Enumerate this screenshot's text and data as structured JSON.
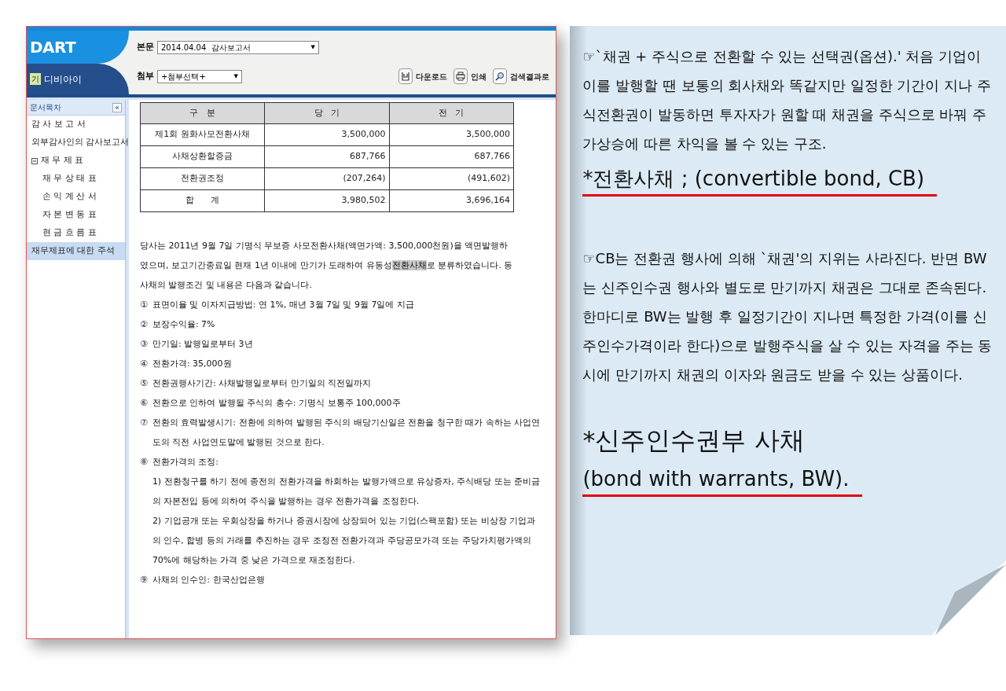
{
  "dart_window": {
    "header": {
      "logo": "DART",
      "brand_badge": "기",
      "brand": "디비아이",
      "fields": [
        {
          "label": "본문",
          "value": "2014.04.04  감사보고서",
          "arrow": "▼"
        },
        {
          "label": "첨부",
          "value": "+첨부선택+",
          "arrow": "▼"
        }
      ],
      "tools": [
        {
          "kind": "download",
          "label": "다운로드"
        },
        {
          "kind": "print",
          "label": "인쇄"
        },
        {
          "kind": "search",
          "label": "검색결과로"
        }
      ]
    },
    "sidebar": {
      "title": "문서목차",
      "collapse": "«",
      "items": [
        {
          "label": "감 사 보 고 서",
          "selected": false
        },
        {
          "label": "외부감사인의 감사보고서",
          "selected": false
        },
        {
          "label": "재 무 제 표",
          "selected": false,
          "expanded": true,
          "children": [
            {
              "label": "재 무 상 태 표",
              "selected": false
            },
            {
              "label": "손 익 계 산 서",
              "selected": false
            },
            {
              "label": "자 본 변 동 표",
              "selected": false
            },
            {
              "label": "현 금 흐 름 표",
              "selected": false
            }
          ]
        },
        {
          "label": "재무제표에 대한 주석",
          "selected": true
        }
      ]
    },
    "table": {
      "columns": [
        "구   분",
        "당   기",
        "전   기"
      ],
      "rows": [
        [
          "제1회 원화사모전환사채",
          "3,500,000",
          "3,500,000"
        ],
        [
          "사채상환할증금",
          "687,766",
          "687,766"
        ],
        [
          "전환권조정",
          "(207,264)",
          "(491,602)"
        ],
        [
          "합      계",
          "3,980,502",
          "3,696,164"
        ]
      ]
    },
    "paragraph": [
      {
        "text": "당사는 2011년 9월 7일 기명식 무보증 사모전환사채(액면가액: 3,500,000천원)을 액면발행하였으며, 보고기간종료일 현재 1년 이내에 만기가 도래하여 유동성",
        "highlighted": false
      },
      {
        "text": "전환사채",
        "highlighted": true
      },
      {
        "text": "로 분류하였습니다. 동 사채의 발행조건 및 내용은 다음과 같습니다.",
        "highlighted": false
      }
    ],
    "terms": [
      {
        "marker": "①",
        "text": "표면이율 및 이자지급방법: 연 1%, 매년 3월 7일 및 9월 7일에 지급"
      },
      {
        "marker": "②",
        "text": "보장수익율: 7%"
      },
      {
        "marker": "③",
        "text": "만기일: 발행일로부터 3년"
      },
      {
        "marker": "④",
        "text": "전환가격: 35,000원"
      },
      {
        "marker": "⑤",
        "text": "전환권행사기간: 사채발행일로부터 만기일의 직전일까지"
      },
      {
        "marker": "⑥",
        "text": "전환으로 인하여 발행될 주식의 총수: 기명식 보통주 100,000주"
      },
      {
        "marker": "⑦",
        "text": "전환의 효력발생시기: 전환에 의하여 발행된 주식의 배당기산일은 전환을 청구한 때가 속하는 사업연도의 직전 사업연도말에 발행된 것으로 한다."
      },
      {
        "marker": "⑧",
        "text": "전환가격의 조정:",
        "sub": [
          "1) 전환청구를 하기 전에 종전의 전환가격을 하회하는 발행가액으로 유상증자, 주식배당 또는 준비금의 자본전입 등에 의하여 주식을 발행하는 경우 전환가격을 조정한다.",
          "2) 기업공개 또는 우회상장을 하거나 증권시장에 상장되어 있는 기업(스팩포함) 또는 비상장 기업과의 인수, 합병 등의 거래를 추진하는 경우 조정전 전환가격과 주당공모가격 또는 주당가치평가액의 70%에 해당하는 가격 중 낮은 가격으로 재조정한다."
        ]
      },
      {
        "marker": "⑨",
        "text": "사채의 인수인: 한국산업은행"
      }
    ]
  },
  "note": {
    "blocks": [
      {
        "kind": "text",
        "text": "☞`채권 + 주식으로 전환할 수 있는 선택권(옵션).' 처음 기업이 이를 발행할 땐 보통의 회사채와 똑같지만 일정한 기간이 지나 주식전환권이 발동하면 투자자가 원할 때 채권을 주식으로 바꿔 주가상승에 따른 차익을 볼 수 있는 구조."
      },
      {
        "kind": "heading",
        "text": "*전환사채 ; (convertible bond, CB)"
      },
      {
        "kind": "text",
        "text": "☞CB는 전환권 행사에 의해 `채권'의 지위는 사라진다. 반면 BW는 신주인수권 행사와 별도로 만기까지 채권은 그대로 존속된다. 한마디로 BW는 발행 후 일정기간이 지나면 특정한 가격(이를 신주인수가격이라 한다)으로 발행주식을 살 수 있는 자격을 주는 동시에 만기까지 채권의 이자와 원금도 받을 수 있는 상품이다."
      },
      {
        "kind": "title",
        "text": "*신주인수권부 사채"
      },
      {
        "kind": "heading",
        "text": "(bond with warrants, BW)."
      }
    ]
  }
}
